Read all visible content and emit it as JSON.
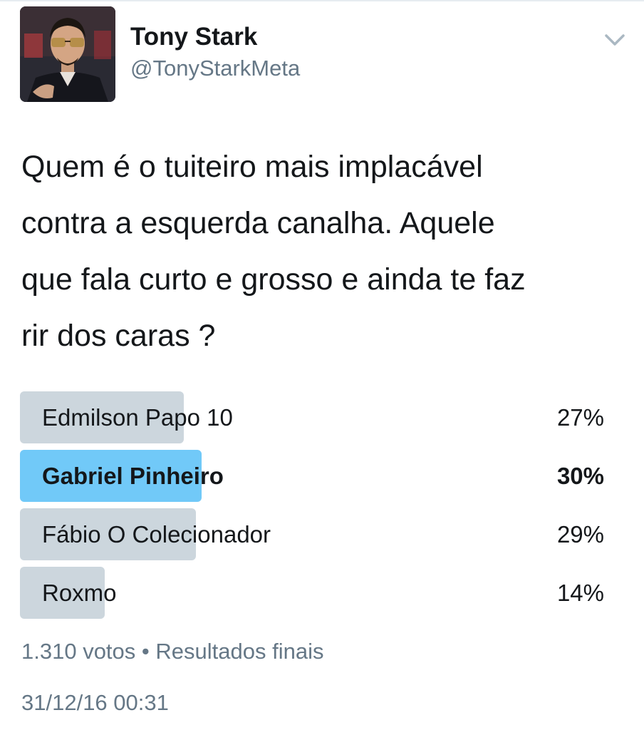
{
  "tweet": {
    "author_name": "Tony Stark",
    "author_handle": "@TonyStarkMeta",
    "text": "Quem é o tuiteiro mais implacável\ncontra a esquerda canalha. Aquele\nque fala curto e grosso e ainda te faz\nrir dos caras ?",
    "timestamp": "31/12/16 00:31",
    "menu_icon": "chevron-down-icon"
  },
  "poll": {
    "options": [
      {
        "label": "Edmilson Papo 10",
        "percent_label": "27%",
        "percent": 27,
        "winner": false
      },
      {
        "label": "Gabriel Pinheiro",
        "percent_label": "30%",
        "percent": 30,
        "winner": true
      },
      {
        "label": "Fábio O Colecionador",
        "percent_label": "29%",
        "percent": 29,
        "winner": false
      },
      {
        "label": "Roxmo",
        "percent_label": "14%",
        "percent": 14,
        "winner": false
      }
    ],
    "votes": "1.310 votos",
    "separator": "•",
    "status": "Resultados finais"
  },
  "colors": {
    "bar": "#ccd6dd",
    "winner_bar": "#71c9f8",
    "text": "#14171a",
    "muted": "#657786"
  }
}
